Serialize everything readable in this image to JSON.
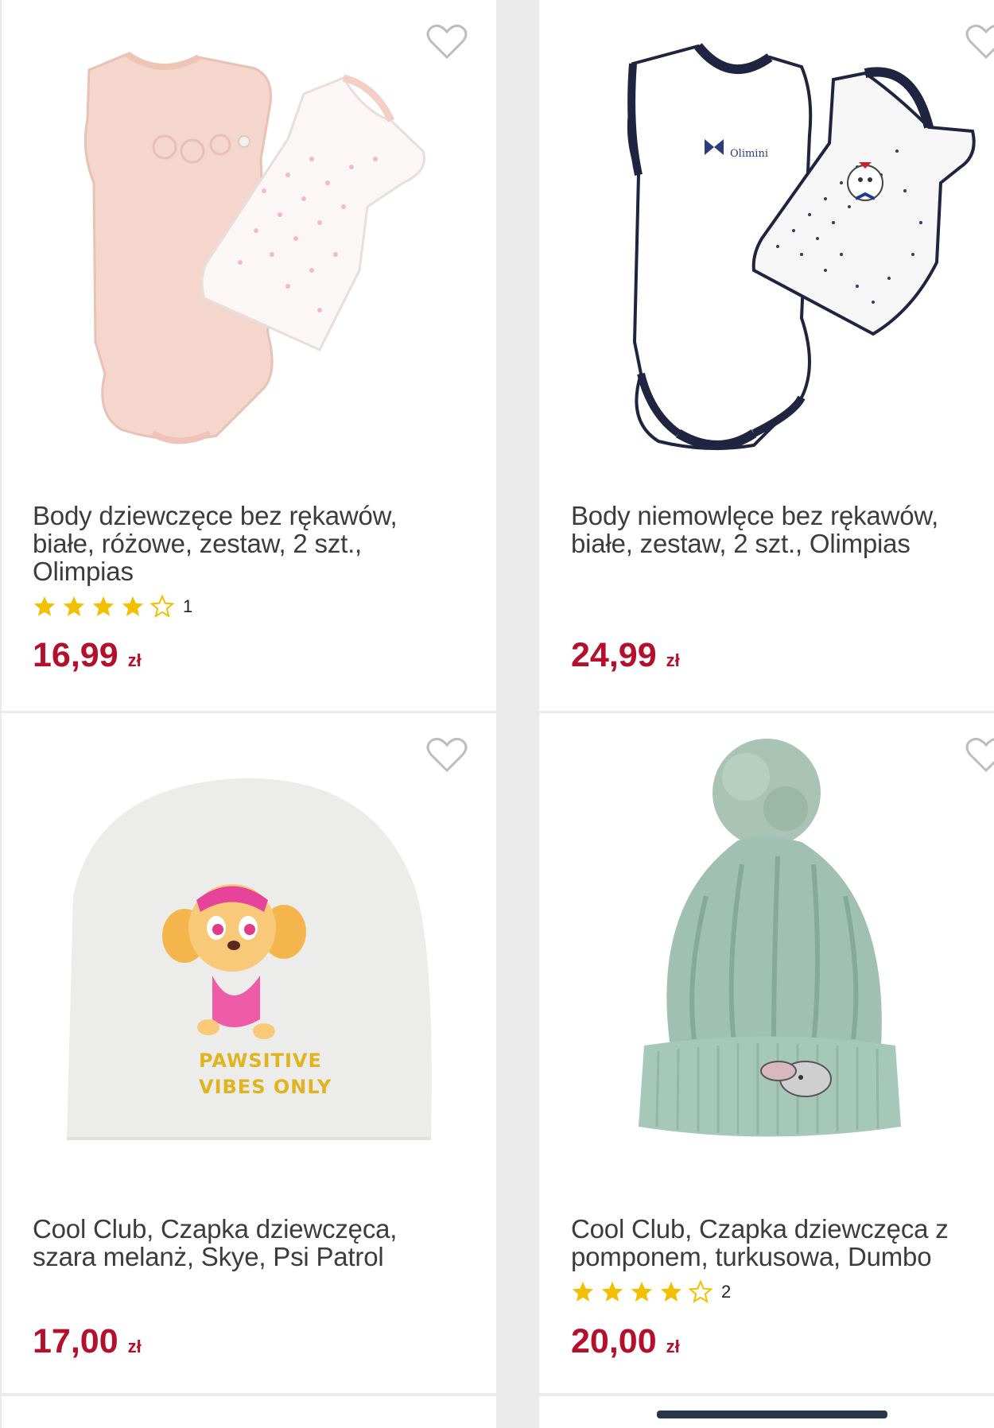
{
  "products": [
    {
      "title": "Body dziewczęce bez rękawów, białe, różowe, zestaw, 2 szt., Olimpias",
      "rating": 4,
      "rating_count": "1",
      "price": "16,99",
      "currency": "zł",
      "image_icon": "pink-white-bodysuit-set-image"
    },
    {
      "title": "Body niemowlęce bez rękawów, białe, zestaw, 2 szt., Olimpias",
      "price": "24,99",
      "currency": "zł",
      "image_icon": "white-navy-bodysuit-set-image"
    },
    {
      "title": "Cool Club, Czapka dziewczęca, szara melanż, Skye, Psi Patrol",
      "price": "17,00",
      "currency": "zł",
      "image_icon": "grey-paw-patrol-beanie-image"
    },
    {
      "title": "Cool Club, Czapka dziewczęca z pomponem, turkusowa, Dumbo",
      "rating": 4,
      "rating_count": "2",
      "price": "20,00",
      "currency": "zł",
      "image_icon": "turquoise-pompom-hat-image"
    }
  ],
  "colors": {
    "price": "#b40f2b",
    "star": "#f3c000",
    "heart_outline": "#bdbdbd"
  }
}
